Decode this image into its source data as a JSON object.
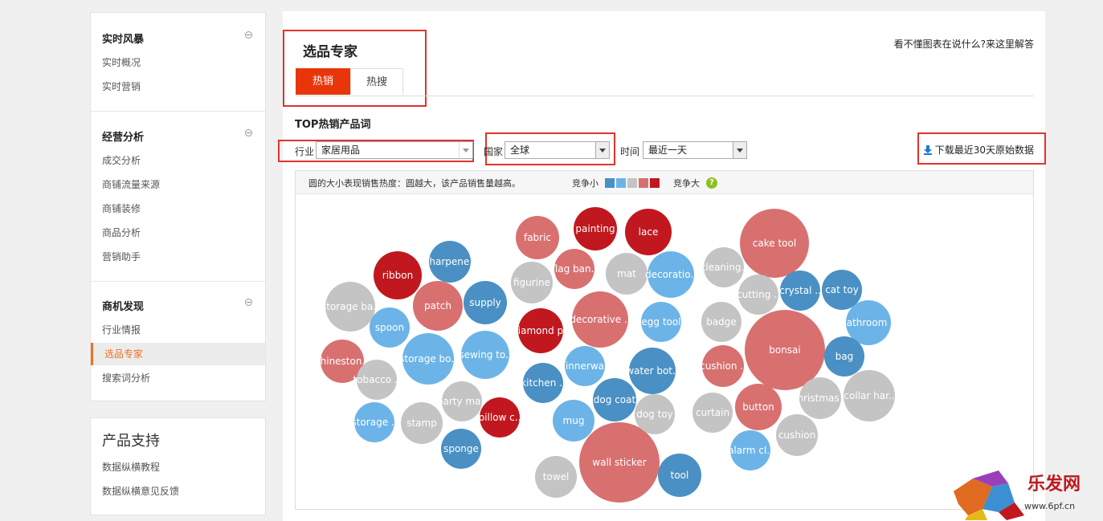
{
  "sidebar": {
    "sections": [
      {
        "title": "实时风暴",
        "items": [
          "实时概况",
          "实时营销"
        ]
      },
      {
        "title": "经营分析",
        "items": [
          "成交分析",
          "商铺流量来源",
          "商铺装修",
          "商品分析",
          "营销助手"
        ]
      },
      {
        "title": "商机发现",
        "items": [
          "行业情报",
          "选品专家",
          "搜索词分析"
        ]
      }
    ],
    "support": {
      "title": "产品支持",
      "items": [
        "数据纵横教程",
        "数据纵横意见反馈"
      ]
    }
  },
  "main": {
    "title": "选品专家",
    "tabs": [
      {
        "label": "热销"
      },
      {
        "label": "热搜"
      }
    ],
    "help_link": "看不懂图表在说什么?来这里解答",
    "section_title": "TOP热销产品词",
    "filters": {
      "industry_label": "行业",
      "industry_value": "家居用品",
      "country_label": "国家",
      "country_value": "全球",
      "time_label": "时间",
      "time_value": "最近一天"
    },
    "download_label": "下载最近30天原始数据",
    "chart_note": "圆的大小表现销售热度：圆越大，该产品销售量越高。",
    "legend_low": "竞争小",
    "legend_high": "竞争大",
    "help_icon": "?"
  },
  "watermark": {
    "brand": "乐发网",
    "url": "www.6pf.cn"
  },
  "colors": {
    "accent": "#e8360a",
    "highlight_box": "#e0332e",
    "competition_scale": [
      "#4a90c4",
      "#6cb4e8",
      "#c4c4c4",
      "#d97070",
      "#c0181e"
    ]
  },
  "chart_data": {
    "type": "bubble",
    "size_meaning": "sales heat",
    "color_meaning": "competition level 1 (low) to 5 (high)",
    "items": [
      {
        "label": "cake tool",
        "size": 10,
        "level": 4
      },
      {
        "label": "bonsai",
        "size": 13,
        "level": 4
      },
      {
        "label": "wall sticker",
        "size": 13,
        "level": 4
      },
      {
        "label": "decorative ..",
        "size": 6,
        "level": 4
      },
      {
        "label": "fabric",
        "size": 4,
        "level": 4
      },
      {
        "label": "painting",
        "size": 4,
        "level": 5
      },
      {
        "label": "lace",
        "size": 4,
        "level": 5
      },
      {
        "label": "ribbon",
        "size": 4,
        "level": 5
      },
      {
        "label": "sharpene..",
        "size": 3,
        "level": 1
      },
      {
        "label": "flag ban..",
        "size": 3,
        "level": 4
      },
      {
        "label": "mat",
        "size": 3,
        "level": 3
      },
      {
        "label": "decoratio..",
        "size": 4,
        "level": 2
      },
      {
        "label": "cleaning..",
        "size": 3,
        "level": 3
      },
      {
        "label": "storage ba..",
        "size": 4,
        "level": 3
      },
      {
        "label": "patch",
        "size": 4,
        "level": 4
      },
      {
        "label": "supply",
        "size": 3,
        "level": 1
      },
      {
        "label": "figurine",
        "size": 3,
        "level": 3
      },
      {
        "label": "cutting ..",
        "size": 3,
        "level": 3
      },
      {
        "label": "crystal ..",
        "size": 3,
        "level": 1
      },
      {
        "label": "cat toy",
        "size": 3,
        "level": 1
      },
      {
        "label": "spoon",
        "size": 3,
        "level": 2
      },
      {
        "label": "diamond p..",
        "size": 3,
        "level": 5
      },
      {
        "label": "egg tool",
        "size": 3,
        "level": 2
      },
      {
        "label": "badge",
        "size": 3,
        "level": 3
      },
      {
        "label": "bathroom ..",
        "size": 3,
        "level": 2
      },
      {
        "label": "rhineston..",
        "size": 3,
        "level": 4
      },
      {
        "label": "storage bo..",
        "size": 4,
        "level": 2
      },
      {
        "label": "sewing to..",
        "size": 4,
        "level": 2
      },
      {
        "label": "dinnerwa..",
        "size": 3,
        "level": 2
      },
      {
        "label": "water bot..",
        "size": 4,
        "level": 1
      },
      {
        "label": "cushion ..",
        "size": 3,
        "level": 4
      },
      {
        "label": "bag",
        "size": 3,
        "level": 1
      },
      {
        "label": "tobacco ..",
        "size": 3,
        "level": 3
      },
      {
        "label": "kitchen ..",
        "size": 3,
        "level": 1
      },
      {
        "label": "party ma..",
        "size": 3,
        "level": 3
      },
      {
        "label": "dog coat",
        "size": 3,
        "level": 1
      },
      {
        "label": "christmas ..",
        "size": 3,
        "level": 3
      },
      {
        "label": "collar har..",
        "size": 4,
        "level": 3
      },
      {
        "label": "storage ..",
        "size": 3,
        "level": 2
      },
      {
        "label": "stamp",
        "size": 3,
        "level": 3
      },
      {
        "label": "pillow c..",
        "size": 3,
        "level": 5
      },
      {
        "label": "mug",
        "size": 3,
        "level": 2
      },
      {
        "label": "dog toy",
        "size": 3,
        "level": 3
      },
      {
        "label": "curtain",
        "size": 3,
        "level": 3
      },
      {
        "label": "button",
        "size": 3,
        "level": 4
      },
      {
        "label": "sponge",
        "size": 3,
        "level": 1
      },
      {
        "label": "cushion",
        "size": 3,
        "level": 3
      },
      {
        "label": "alarm cl..",
        "size": 3,
        "level": 2
      },
      {
        "label": "towel",
        "size": 3,
        "level": 3
      },
      {
        "label": "tool",
        "size": 3,
        "level": 1
      }
    ]
  }
}
